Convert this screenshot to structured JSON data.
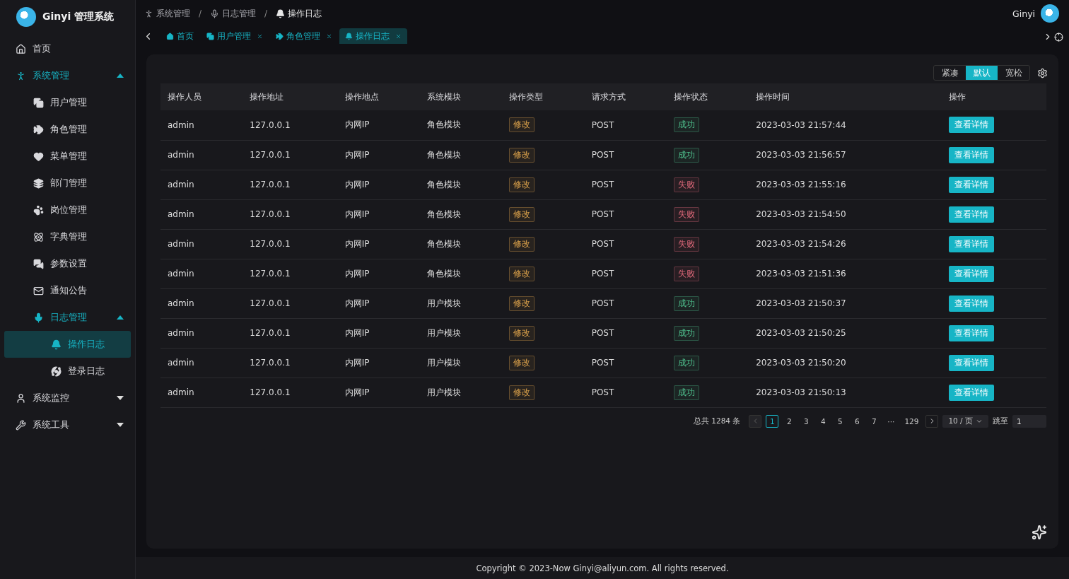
{
  "brand": {
    "title": "Ginyi 管理系统"
  },
  "sidebar": {
    "items": [
      {
        "label": "首页",
        "selected": false
      },
      {
        "label": "系统管理",
        "selected": false,
        "expanded": true,
        "active": true,
        "children": [
          {
            "label": "用户管理",
            "selected": false
          },
          {
            "label": "角色管理",
            "selected": false
          },
          {
            "label": "菜单管理",
            "selected": false
          },
          {
            "label": "部门管理",
            "selected": false
          },
          {
            "label": "岗位管理",
            "selected": false
          },
          {
            "label": "字典管理",
            "selected": false
          },
          {
            "label": "参数设置",
            "selected": false
          },
          {
            "label": "通知公告",
            "selected": false
          },
          {
            "label": "日志管理",
            "selected": false,
            "expanded": true,
            "active": true,
            "children": [
              {
                "label": "操作日志",
                "selected": true
              },
              {
                "label": "登录日志",
                "selected": false
              }
            ]
          }
        ]
      },
      {
        "label": "系统监控",
        "selected": false,
        "expanded": false,
        "active": false
      },
      {
        "label": "系统工具",
        "selected": false,
        "expanded": false,
        "active": false
      }
    ]
  },
  "breadcrumb": [
    {
      "label": "系统管理",
      "separator": "/"
    },
    {
      "label": "日志管理",
      "separator": "/"
    },
    {
      "label": "操作日志"
    }
  ],
  "user": {
    "name": "Ginyi"
  },
  "tabs": [
    {
      "label": "首页",
      "selected": false,
      "closable": false
    },
    {
      "label": "用户管理",
      "selected": false,
      "closable": true
    },
    {
      "label": "角色管理",
      "selected": false,
      "closable": true
    },
    {
      "label": "操作日志",
      "selected": true,
      "closable": true
    }
  ],
  "density": [
    {
      "label": "紧凑",
      "selected": false
    },
    {
      "label": "默认",
      "selected": true
    },
    {
      "label": "宽松",
      "selected": false
    }
  ],
  "table": {
    "columns": [
      "操作人员",
      "操作地址",
      "操作地点",
      "系统模块",
      "操作类型",
      "请求方式",
      "操作状态",
      "操作时间",
      "操作"
    ],
    "rows": [
      {
        "user": "admin",
        "ip": "127.0.0.1",
        "location": "内网IP",
        "module": "角色模块",
        "type": "修改",
        "method": "POST",
        "status": {
          "label": "成功",
          "kind": "success"
        },
        "time": "2023-03-03 21:57:44",
        "action": "查看详情"
      },
      {
        "user": "admin",
        "ip": "127.0.0.1",
        "location": "内网IP",
        "module": "角色模块",
        "type": "修改",
        "method": "POST",
        "status": {
          "label": "成功",
          "kind": "success"
        },
        "time": "2023-03-03 21:56:57",
        "action": "查看详情"
      },
      {
        "user": "admin",
        "ip": "127.0.0.1",
        "location": "内网IP",
        "module": "角色模块",
        "type": "修改",
        "method": "POST",
        "status": {
          "label": "失败",
          "kind": "fail"
        },
        "time": "2023-03-03 21:55:16",
        "action": "查看详情"
      },
      {
        "user": "admin",
        "ip": "127.0.0.1",
        "location": "内网IP",
        "module": "角色模块",
        "type": "修改",
        "method": "POST",
        "status": {
          "label": "失败",
          "kind": "fail"
        },
        "time": "2023-03-03 21:54:50",
        "action": "查看详情"
      },
      {
        "user": "admin",
        "ip": "127.0.0.1",
        "location": "内网IP",
        "module": "角色模块",
        "type": "修改",
        "method": "POST",
        "status": {
          "label": "失败",
          "kind": "fail"
        },
        "time": "2023-03-03 21:54:26",
        "action": "查看详情"
      },
      {
        "user": "admin",
        "ip": "127.0.0.1",
        "location": "内网IP",
        "module": "角色模块",
        "type": "修改",
        "method": "POST",
        "status": {
          "label": "失败",
          "kind": "fail"
        },
        "time": "2023-03-03 21:51:36",
        "action": "查看详情"
      },
      {
        "user": "admin",
        "ip": "127.0.0.1",
        "location": "内网IP",
        "module": "用户模块",
        "type": "修改",
        "method": "POST",
        "status": {
          "label": "成功",
          "kind": "success"
        },
        "time": "2023-03-03 21:50:37",
        "action": "查看详情"
      },
      {
        "user": "admin",
        "ip": "127.0.0.1",
        "location": "内网IP",
        "module": "用户模块",
        "type": "修改",
        "method": "POST",
        "status": {
          "label": "成功",
          "kind": "success"
        },
        "time": "2023-03-03 21:50:25",
        "action": "查看详情"
      },
      {
        "user": "admin",
        "ip": "127.0.0.1",
        "location": "内网IP",
        "module": "用户模块",
        "type": "修改",
        "method": "POST",
        "status": {
          "label": "成功",
          "kind": "success"
        },
        "time": "2023-03-03 21:50:20",
        "action": "查看详情"
      },
      {
        "user": "admin",
        "ip": "127.0.0.1",
        "location": "内网IP",
        "module": "用户模块",
        "type": "修改",
        "method": "POST",
        "status": {
          "label": "成功",
          "kind": "success"
        },
        "time": "2023-03-03 21:50:13",
        "action": "查看详情"
      }
    ]
  },
  "pagination": {
    "total": "总共 1284 条",
    "pages": [
      {
        "label": "1",
        "selected": true
      },
      {
        "label": "2",
        "selected": false
      },
      {
        "label": "3",
        "selected": false
      },
      {
        "label": "4",
        "selected": false
      },
      {
        "label": "5",
        "selected": false
      },
      {
        "label": "6",
        "selected": false
      },
      {
        "label": "7",
        "selected": false
      },
      {
        "label": "···",
        "selected": false
      },
      {
        "label": "129",
        "selected": false
      }
    ],
    "page_size": "10 / 页",
    "jump_label": "跳至",
    "jump_value": "1"
  },
  "footer": "Copyright © 2023-Now Ginyi@aliyun.com. All rights reserved."
}
